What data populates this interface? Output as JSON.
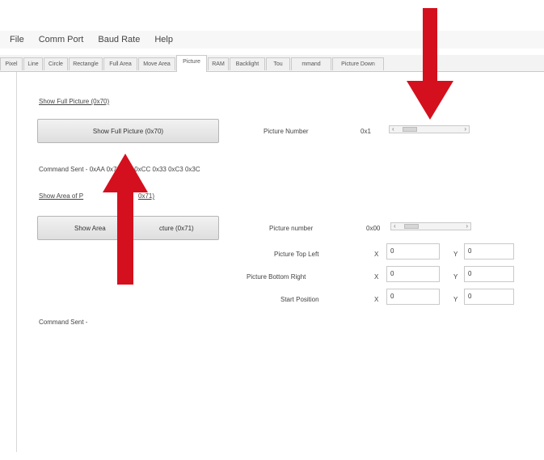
{
  "menu": [
    "File",
    "Comm Port",
    "Baud Rate",
    "Help"
  ],
  "tabs": [
    "Pixel",
    "Line",
    "Circle",
    "Rectangle",
    "Full Area",
    "Move Area",
    "Picture",
    "RAM",
    "Backlight",
    "Tou",
    "mmand",
    "Picture Down"
  ],
  "active_tab_index": 6,
  "full": {
    "section_label": "Show Full Picture (0x70)",
    "button_label": "Show Full Picture (0x70)",
    "picture_number_label": "Picture Number",
    "picture_number_value": "0x1",
    "command_sent": "Command Sent - 0xAA 0x70 0x1 0xCC 0x33 0xC3 0x3C"
  },
  "area": {
    "section_label_left": "Show Area of P",
    "section_label_right": "0x71)",
    "button_label_left": "Show Area",
    "button_label_right": "cture (0x71)",
    "picture_number_label": "Picture number",
    "picture_number_value": "0x00",
    "top_left_label": "Picture Top Left",
    "bottom_right_label": "Picture Bottom Right",
    "start_position_label": "Start Position",
    "x_label": "X",
    "y_label": "Y",
    "top_left_x": "0",
    "top_left_y": "0",
    "bottom_right_x": "0",
    "bottom_right_y": "0",
    "start_x": "0",
    "start_y": "0",
    "command_sent": "Command Sent -"
  },
  "colors": {
    "arrow": "#d4101e"
  },
  "icons": {
    "scroll_left": "‹",
    "scroll_right": "›"
  }
}
